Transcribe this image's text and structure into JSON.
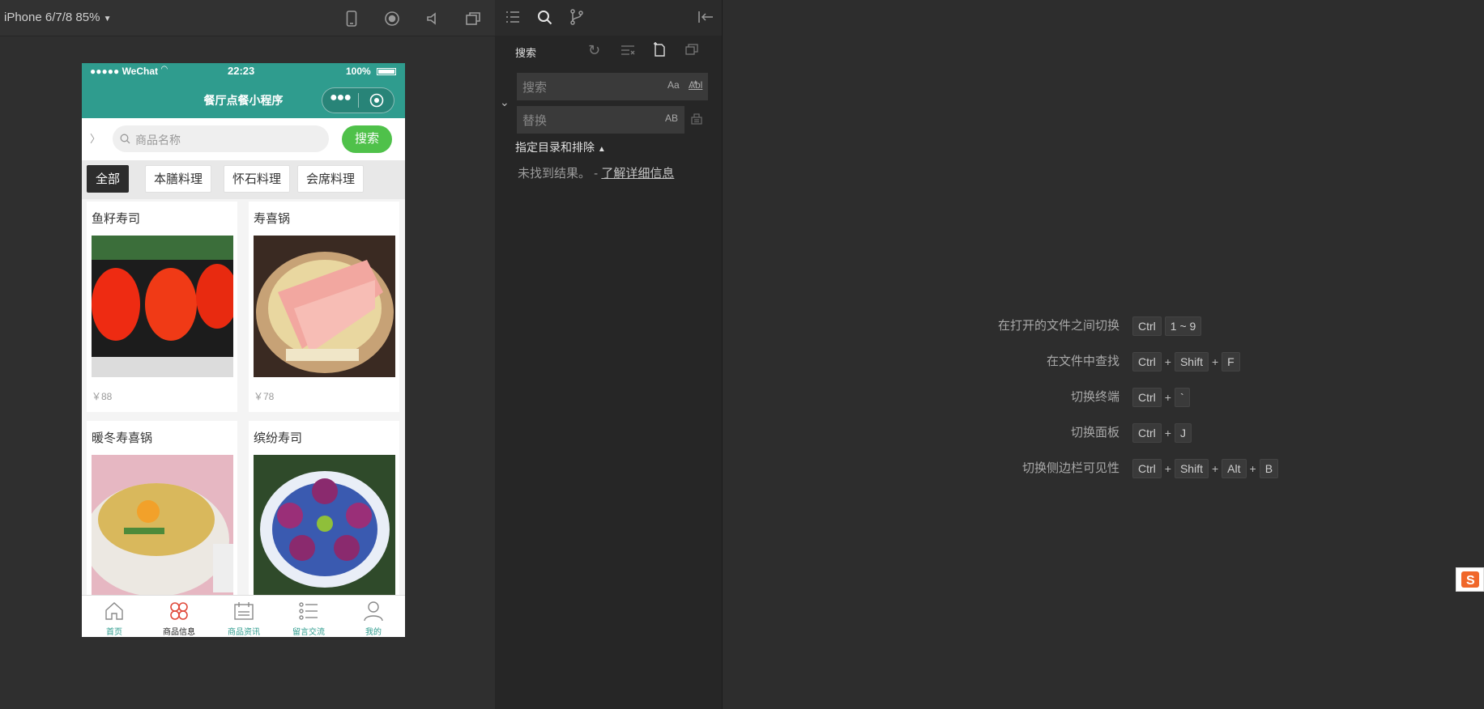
{
  "simulator": {
    "device_label": "iPhone 6/7/8 85%",
    "status": {
      "carrier": "●●●●● WeChat",
      "time": "22:23",
      "battery": "100%"
    },
    "nav_title": "餐厅点餐小程序",
    "search": {
      "placeholder": "商品名称",
      "button": "搜索",
      "arrow": "〉"
    },
    "categories": [
      "全部",
      "本膳料理",
      "怀石料理",
      "会席料理"
    ],
    "products": [
      {
        "name": "鱼籽寿司",
        "price": "￥88"
      },
      {
        "name": "寿喜锅",
        "price": "￥78"
      },
      {
        "name": "暖冬寿喜锅",
        "price": ""
      },
      {
        "name": "缤纷寿司",
        "price": ""
      }
    ],
    "tabs": [
      "首页",
      "商品信息",
      "商品资讯",
      "留言交流",
      "我的"
    ]
  },
  "search_panel": {
    "title": "搜索",
    "search_placeholder": "搜索",
    "replace_placeholder": "替换",
    "option_case": "Aa",
    "option_word": "Abl",
    "option_regex": ".*",
    "option_preserve": "AB",
    "scope_label": "指定目录和排除",
    "no_result": "未找到结果。 -",
    "learn_more": "了解详细信息"
  },
  "shortcuts": [
    {
      "label": "在打开的文件之间切换",
      "keys": [
        "Ctrl",
        "1 ~ 9"
      ]
    },
    {
      "label": "在文件中查找",
      "keys": [
        "Ctrl",
        "+",
        "Shift",
        "+",
        "F"
      ]
    },
    {
      "label": "切换终端",
      "keys": [
        "Ctrl",
        "+",
        "`"
      ]
    },
    {
      "label": "切换面板",
      "keys": [
        "Ctrl",
        "+",
        "J"
      ]
    },
    {
      "label": "切换侧边栏可见性",
      "keys": [
        "Ctrl",
        "+",
        "Shift",
        "+",
        "Alt",
        "+",
        "B"
      ]
    }
  ],
  "colors": {
    "nav": "#2f9c8e",
    "search_button": "#4fc14a",
    "active_category": "#2d2d2d"
  }
}
